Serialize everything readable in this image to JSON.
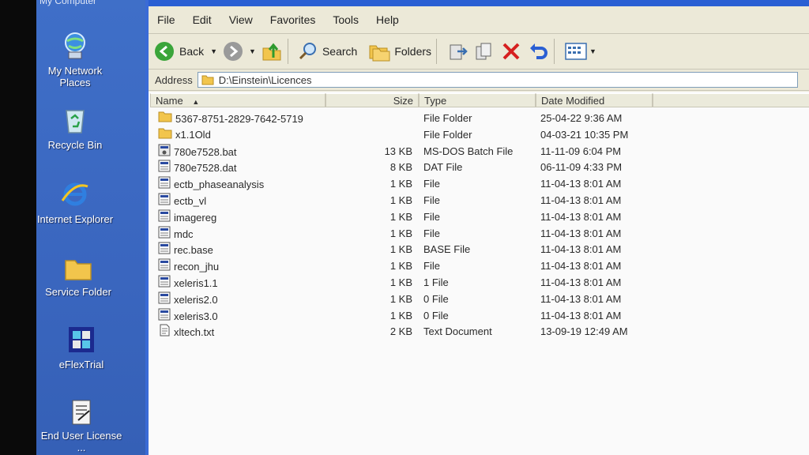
{
  "desktop": {
    "top_caption": "My Computer",
    "icons": [
      {
        "label": "My Network Places",
        "icon": "network-places-icon"
      },
      {
        "label": "Recycle Bin",
        "icon": "recycle-bin-icon"
      },
      {
        "label": "Internet Explorer",
        "icon": "internet-explorer-icon"
      },
      {
        "label": "Service Folder",
        "icon": "folder-icon"
      },
      {
        "label": "eFlexTrial",
        "icon": "eflextrial-icon"
      },
      {
        "label": "End User License ...",
        "icon": "license-document-icon"
      }
    ]
  },
  "menu": [
    "File",
    "Edit",
    "View",
    "Favorites",
    "Tools",
    "Help"
  ],
  "toolbar": {
    "back_label": "Back",
    "search_label": "Search",
    "folders_label": "Folders"
  },
  "address": {
    "label": "Address",
    "path": "D:\\Einstein\\Licences"
  },
  "columns": {
    "name": "Name",
    "size": "Size",
    "type": "Type",
    "date": "Date Modified"
  },
  "files": [
    {
      "name": "5367-8751-2829-7642-5719",
      "size": "",
      "type": "File Folder",
      "date": "25-04-22 9:36 AM",
      "icon": "folder-icon"
    },
    {
      "name": "x1.1Old",
      "size": "",
      "type": "File Folder",
      "date": "04-03-21 10:35 PM",
      "icon": "folder-icon"
    },
    {
      "name": "780e7528.bat",
      "size": "13 KB",
      "type": "MS-DOS Batch File",
      "date": "11-11-09 6:04 PM",
      "icon": "batch-file-icon"
    },
    {
      "name": "780e7528.dat",
      "size": "8 KB",
      "type": "DAT File",
      "date": "06-11-09 4:33 PM",
      "icon": "generic-file-icon"
    },
    {
      "name": "ectb_phaseanalysis",
      "size": "1 KB",
      "type": "File",
      "date": "11-04-13 8:01 AM",
      "icon": "generic-file-icon"
    },
    {
      "name": "ectb_vl",
      "size": "1 KB",
      "type": "File",
      "date": "11-04-13 8:01 AM",
      "icon": "generic-file-icon"
    },
    {
      "name": "imagereg",
      "size": "1 KB",
      "type": "File",
      "date": "11-04-13 8:01 AM",
      "icon": "generic-file-icon"
    },
    {
      "name": "mdc",
      "size": "1 KB",
      "type": "File",
      "date": "11-04-13 8:01 AM",
      "icon": "generic-file-icon"
    },
    {
      "name": "rec.base",
      "size": "1 KB",
      "type": "BASE File",
      "date": "11-04-13 8:01 AM",
      "icon": "generic-file-icon"
    },
    {
      "name": "recon_jhu",
      "size": "1 KB",
      "type": "File",
      "date": "11-04-13 8:01 AM",
      "icon": "generic-file-icon"
    },
    {
      "name": "xeleris1.1",
      "size": "1 KB",
      "type": "1 File",
      "date": "11-04-13 8:01 AM",
      "icon": "generic-file-icon"
    },
    {
      "name": "xeleris2.0",
      "size": "1 KB",
      "type": "0 File",
      "date": "11-04-13 8:01 AM",
      "icon": "generic-file-icon"
    },
    {
      "name": "xeleris3.0",
      "size": "1 KB",
      "type": "0 File",
      "date": "11-04-13 8:01 AM",
      "icon": "generic-file-icon"
    },
    {
      "name": "xltech.txt",
      "size": "2 KB",
      "type": "Text Document",
      "date": "13-09-19 12:49 AM",
      "icon": "text-document-icon"
    }
  ],
  "colors": {
    "desktop": "#3a66bf",
    "window_chrome": "#ece9d8",
    "list_bg": "#fafafa",
    "titlebar": "#2a5fd3"
  }
}
